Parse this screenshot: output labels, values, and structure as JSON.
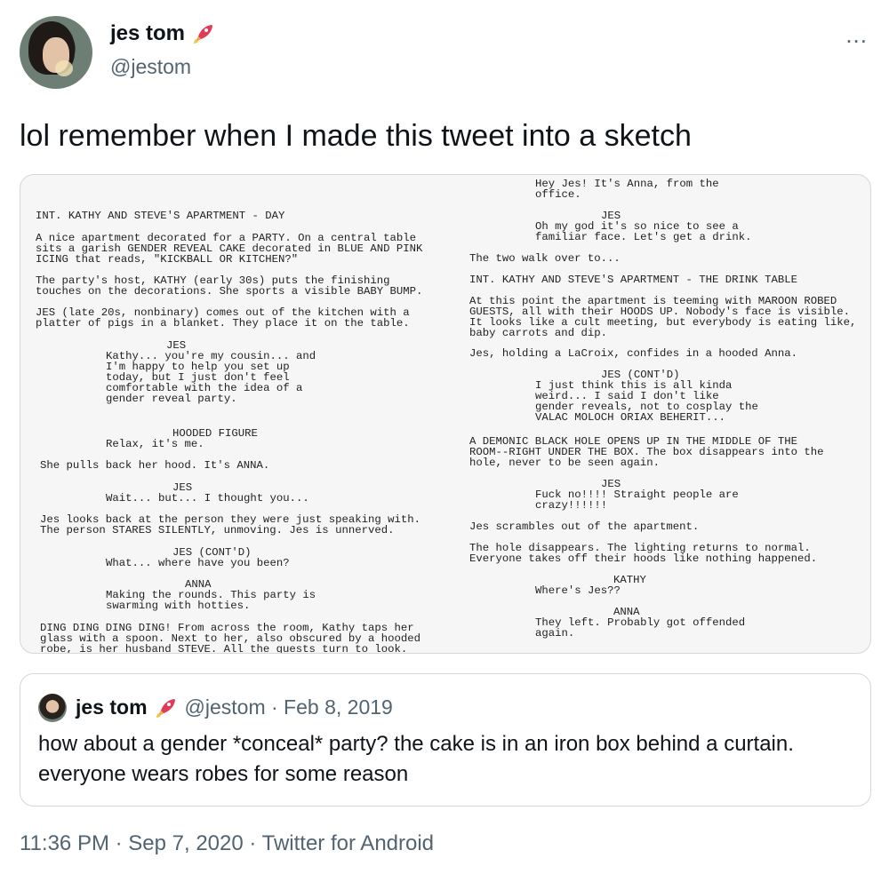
{
  "tweet": {
    "author_name": "jes tom",
    "author_handle": "@jestom",
    "more_icon": "...",
    "text": "lol remember when I made this tweet into a sketch",
    "timestamp": "11:36 PM · Sep 7, 2020 · Twitter for Android"
  },
  "media": {
    "left_column": [
      "INT. KATHY AND STEVE'S APARTMENT - DAY",
      "A nice apartment decorated for a PARTY. On a central table",
      "sits a garish GENDER REVEAL CAKE decorated in BLUE AND PINK",
      "ICING that reads, \"KICKBALL OR KITCHEN?\"",
      "The party's host, KATHY (early 30s) puts the finishing",
      "touches on the decorations. She sports a visible BABY BUMP.",
      "JES (late 20s, nonbinary) comes out of the kitchen with a",
      "platter of pigs in a blanket. They place it on the table.",
      "JES",
      "Kathy... you're my cousin... and",
      "I'm happy to help you set up",
      "today, but I just don't feel",
      "comfortable with the idea of a",
      "gender reveal party.",
      "HOODED FIGURE",
      "Relax, it's me.",
      "She pulls back her hood. It's ANNA.",
      "JES",
      "Wait... but... I thought you...",
      "Jes looks back at the person they were just speaking with.",
      "The person STARES SILENTLY, unmoving. Jes is unnerved.",
      "JES (CONT'D)",
      "What... where have you been?",
      "ANNA",
      "Making the rounds. This party is",
      "swarming with hotties.",
      "DING DING DING DING! From across the room, Kathy taps her",
      "glass with a spoon. Next to her, also obscured by a hooded",
      "robe, is her husband STEVE. All the guests turn to look."
    ],
    "right_column": [
      "Hey Jes! It's Anna, from the",
      "office.",
      "JES",
      "Oh my god it's so nice to see a",
      "familiar face. Let's get a drink.",
      "The two walk over to...",
      "INT. KATHY AND STEVE'S APARTMENT - THE DRINK TABLE",
      "At this point the apartment is teeming with MAROON ROBED",
      "GUESTS, all with their HOODS UP. Nobody's face is visible.",
      "It looks like a cult meeting, but everybody is eating like,",
      "baby carrots and dip.",
      "Jes, holding a LaCroix, confides in a hooded Anna.",
      "JES (CONT'D)",
      "I just think this is all kinda",
      "weird... I said I don't like",
      "gender reveals, not to cosplay the",
      "VALAC MOLOCH ORIAX BEHERIT...",
      "A DEMONIC BLACK HOLE OPENS UP IN THE MIDDLE OF THE",
      "ROOM--RIGHT UNDER THE BOX. The box disappears into the",
      "hole, never to be seen again.",
      "JES",
      "Fuck no!!!! Straight people are",
      "crazy!!!!!!",
      "Jes scrambles out of the apartment.",
      "The hole disappears. The lighting returns to normal.",
      "Everyone takes off their hoods like nothing happened.",
      "KATHY",
      "Where's Jes??",
      "ANNA",
      "They left. Probably got offended",
      "again."
    ]
  },
  "quoted_tweet": {
    "author_name": "jes tom",
    "meta": "@jestom · Feb 8, 2019",
    "text": "how about a gender *conceal* party? the cake is in an iron box behind a curtain. everyone wears robes for some reason"
  },
  "icons": {
    "rocket": "rocket-icon",
    "more": "more-icon"
  }
}
